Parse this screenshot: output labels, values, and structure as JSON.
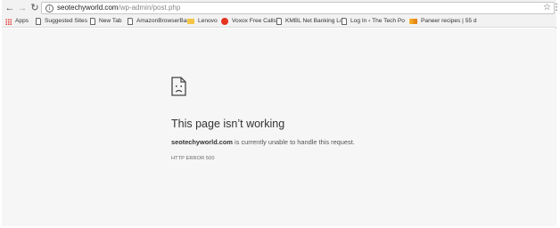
{
  "browser": {
    "url_host": "seotechyworld.com",
    "url_path": "/wp-admin/post.php",
    "bookmarks": [
      {
        "label": "Apps",
        "icon": "apps-grid-icon"
      },
      {
        "label": "Suggested Sites",
        "icon": "page-icon"
      },
      {
        "label": "New Tab",
        "icon": "page-icon"
      },
      {
        "label": "AmazonBrowserBar",
        "icon": "page-icon"
      },
      {
        "label": "Lenovo",
        "icon": "folder-icon"
      },
      {
        "label": "Voxox Free Calls",
        "icon": "voxox-icon"
      },
      {
        "label": "KMBL Net Banking Lo",
        "icon": "page-icon"
      },
      {
        "label": "Log In ‹ The Tech Po",
        "icon": "page-icon"
      },
      {
        "label": "Paneer recipes | 55 d",
        "icon": "paneer-favicon"
      }
    ]
  },
  "error_page": {
    "title": "This page isn’t working",
    "domain": "seotechyworld.com",
    "message": " is currently unable to handle this request.",
    "code": "HTTP ERROR 500"
  }
}
